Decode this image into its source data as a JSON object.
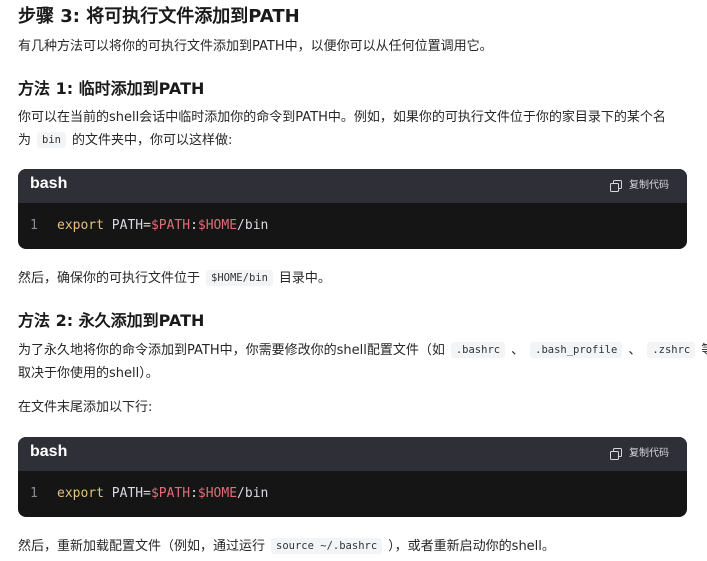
{
  "step_title": "步骤 3: 将可执行文件添加到PATH",
  "intro": "有几种方法可以将你的可执行文件添加到PATH中，以便你可以从任何位置调用它。",
  "method1": {
    "title": "方法 1: 临时添加到PATH",
    "line1": "你可以在当前的shell会话中临时添加你的命令到PATH中。例如，如果你的可执行文件位于你的家目录下的某个名",
    "line2_a": "为",
    "line2_code": "bin",
    "line2_b": "的文件夹中，你可以这样做:",
    "code_block": {
      "lang": "bash",
      "copy_label": "复制代码",
      "line_number": "1",
      "kw": "export",
      "assign": " PATH=",
      "var1": "$PATH",
      "sep": ":",
      "var2": "$HOME",
      "rest": "/bin"
    },
    "after_a": "然后，确保你的可执行文件位于",
    "after_code": "$HOME/bin",
    "after_b": "目录中。"
  },
  "method2": {
    "title": "方法 2: 永久添加到PATH",
    "line1_a": "为了永久地将你的命令添加到PATH中，你需要修改你的shell配置文件（如",
    "code_bashrc": ".bashrc",
    "sep1": "、",
    "code_profile": ".bash_profile",
    "sep2": "、",
    "code_zshrc": ".zshrc",
    "line1_b": "等，",
    "line2": "取决于你使用的shell）。",
    "line3": "在文件末尾添加以下行:",
    "code_block": {
      "lang": "bash",
      "copy_label": "复制代码",
      "line_number": "1",
      "kw": "export",
      "assign": " PATH=",
      "var1": "$PATH",
      "sep": ":",
      "var2": "$HOME",
      "rest": "/bin"
    },
    "after_a": "然后，重新加载配置文件（例如，通过运行",
    "after_code": "source ~/.bashrc",
    "after_b": "），或者重新启动你的shell。"
  },
  "colors": {
    "code_bg": "#151516",
    "code_header_bg": "#2f2f37",
    "keyword": "#e5c07b",
    "variable": "#e06c75"
  },
  "icons": {
    "copy": "copy-icon"
  }
}
